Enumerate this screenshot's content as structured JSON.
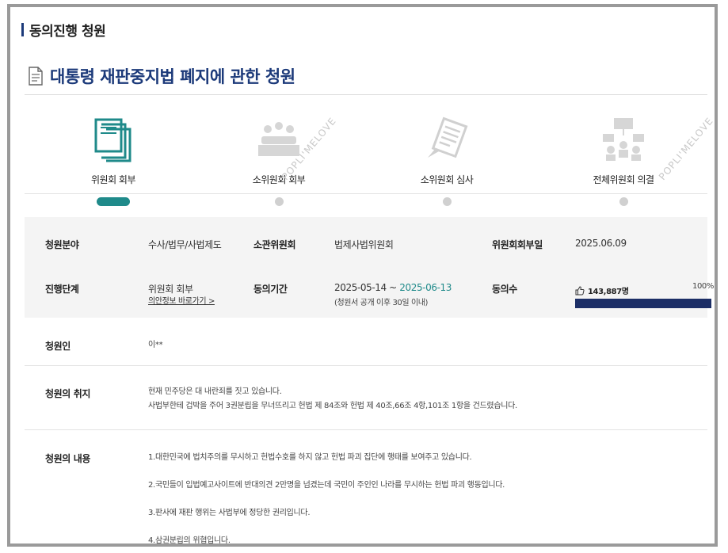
{
  "page": {
    "section_heading": "동의진행 청원",
    "title": "대통령 재판중지법 폐지에 관한 청원",
    "watermark": "POPLI'MELOVE"
  },
  "steps": [
    {
      "label": "위원회 회부",
      "icon": "documents-icon",
      "active": true
    },
    {
      "label": "소위원회 회부",
      "icon": "meeting-table-icon",
      "active": false
    },
    {
      "label": "소위원회 심사",
      "icon": "review-document-icon",
      "active": false
    },
    {
      "label": "전체위원회 의결",
      "icon": "committee-vote-icon",
      "active": false
    }
  ],
  "info": {
    "field_label": "청원분야",
    "field_value": "수사/법무/사법제도",
    "committee_label": "소관위원회",
    "committee_value": "법제사법위원회",
    "referral_date_label": "위원회회부일",
    "referral_date_value": "2025.06.09",
    "stage_label": "진행단계",
    "stage_value": "위원회 회부",
    "stage_link": "의안정보 바로가기 >",
    "period_label": "동의기간",
    "period_start": "2025-05-14 ~ ",
    "period_end": "2025-06-13",
    "period_note": "(청원서 공개 이후 30일 이내)",
    "consent_label": "동의수",
    "consent_count": "143,887명",
    "consent_percent_label": "100%",
    "consent_fraction": 1.0
  },
  "petitioner": {
    "label": "청원인",
    "value": "이**"
  },
  "purpose": {
    "label": "청원의 취지",
    "lines": [
      "현재 민주당은 대 내란죄를 짓고 있습니다.",
      "사법부한테 겁박을 주어 3권분립을 무너뜨리고 헌법 제 84조와 헌법 제 40조,66조 4항,101조 1항을 건드렸습니다."
    ]
  },
  "content": {
    "label": "청원의 내용",
    "lines": [
      "1.대한민국에 법치주의를 무시하고 헌법수호를 하지 않고 헌법 파괴 집단에 행태를 보여주고 있습니다.",
      "2.국민들이 입법예고사이트에 반대의견 2만명을 넘겼는데 국민이 주인인 나라를 무시하는 헌법 파괴 행동입니다.",
      "3.판사에 재판 행위는 사법부에 정당한 권리입니다.",
      "4.삼권분립의 위협입니다."
    ]
  },
  "colors": {
    "accent_teal": "#1f8a8a",
    "title_navy": "#1c3a7a",
    "progress_navy": "#1c2e66"
  }
}
